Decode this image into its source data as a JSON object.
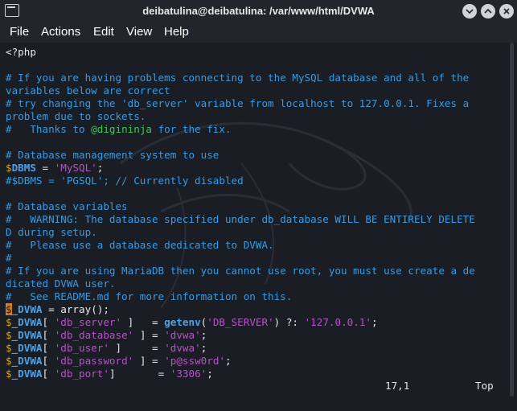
{
  "window": {
    "title": "deibatulina@deibatulina: /var/www/html/DVWA"
  },
  "menu": {
    "items": [
      "File",
      "Actions",
      "Edit",
      "View",
      "Help"
    ]
  },
  "code": {
    "l1": "<?php",
    "l3": "# If you are having problems connecting to the MySQL database and all of the",
    "l4": "variables below are correct",
    "l5": "# try changing the 'db_server' variable from localhost to 127.0.0.1. Fixes a",
    "l6": "problem due to sockets.",
    "l7a": "#   Thanks to ",
    "l7b": "@digininja",
    "l7c": " for the fix.",
    "l9": "# Database management system to use",
    "l10a": "$",
    "l10b": "DBMS",
    "l10c": " = ",
    "l10d": "'MySQL'",
    "l10e": ";",
    "l11": "#$DBMS = 'PGSQL'; // Currently disabled",
    "l13": "# Database variables",
    "l14": "#   WARNING: The database specified under db_database WILL BE ENTIRELY DELETE",
    "l15": "D during setup.",
    "l16": "#   Please use a database dedicated to DVWA.",
    "l17": "#",
    "l18": "# If you are using MariaDB then you cannot use root, you must use create a de",
    "l19": "dicated DVWA user.",
    "l20": "#   See README.md for more information on this.",
    "l21a": "$",
    "l21b": "_DVWA",
    "l21c": " = ",
    "l21d": "array",
    "l21e": "();",
    "l22a": "$",
    "l22b": "_DVWA",
    "l22c": "[ ",
    "l22d": "'db_server'",
    "l22e": " ]   = ",
    "l22f": "getenv",
    "l22g": "(",
    "l22h": "'DB_SERVER'",
    "l22i": ") ?: ",
    "l22j": "'127.0.0.1'",
    "l22k": ";",
    "l23a": "$",
    "l23b": "_DVWA",
    "l23c": "[ ",
    "l23d": "'db_database'",
    "l23e": " ] = ",
    "l23f": "'dvwa'",
    "l23g": ";",
    "l24a": "$",
    "l24b": "_DVWA",
    "l24c": "[ ",
    "l24d": "'db_user'",
    "l24e": " ]     = ",
    "l24f": "'dvwa'",
    "l24g": ";",
    "l25a": "$",
    "l25b": "_DVWA",
    "l25c": "[ ",
    "l25d": "'db_password'",
    "l25e": " ] = ",
    "l25f": "'p@ssw0rd'",
    "l25g": ";",
    "l26a": "$",
    "l26b": "_DVWA",
    "l26c": "[ ",
    "l26d": "'db_port'",
    "l26e": "]       = ",
    "l26f": "'3306'",
    "l26g": ";"
  },
  "status": {
    "position": "17,1",
    "scroll": "Top"
  },
  "colors": {
    "comment": "#3a9ae0",
    "string": "#b256c2",
    "variable": "#4fa1e6",
    "dollar": "#d9a51f",
    "cursor": "#d97b1d"
  }
}
